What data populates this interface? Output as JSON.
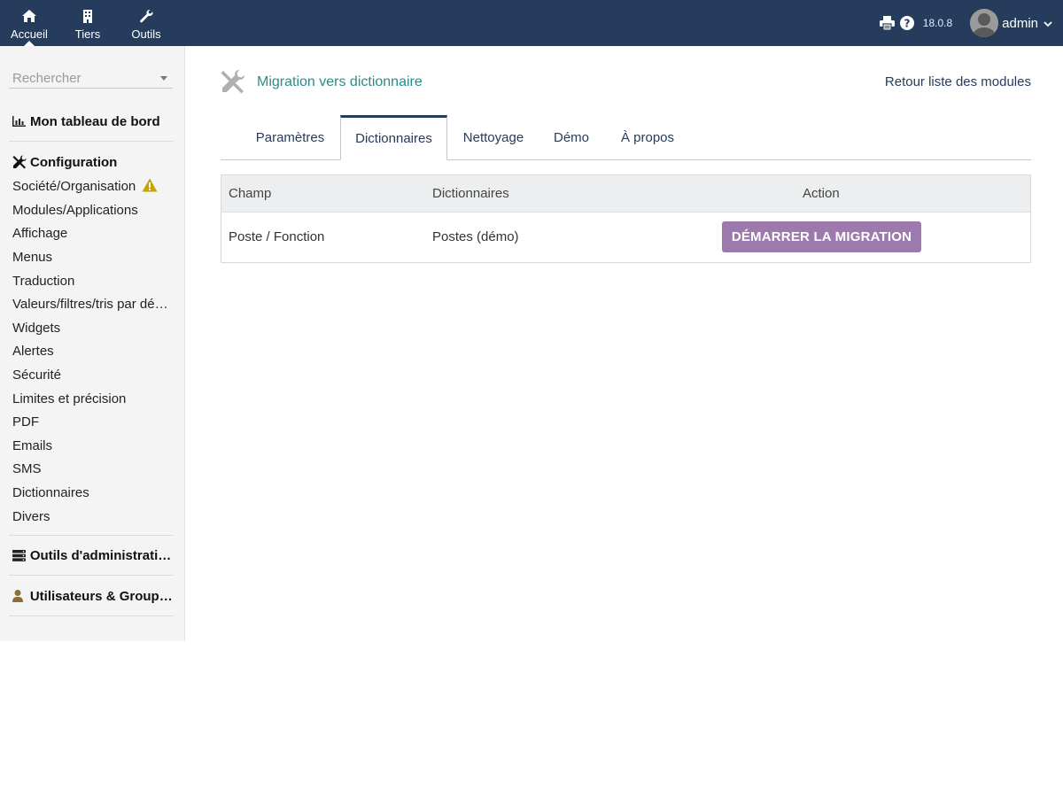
{
  "topmenu": [
    {
      "label": "Accueil",
      "icon": "home-icon"
    },
    {
      "label": "Tiers",
      "icon": "building-icon"
    },
    {
      "label": "Outils",
      "icon": "wrench-icon"
    }
  ],
  "topright": {
    "version": "18.0.8",
    "username": "admin"
  },
  "sidebar": {
    "search_placeholder": "Rechercher",
    "dashboard": "Mon tableau de bord",
    "configuration": "Configuration",
    "config_items": [
      "Société/Organisation",
      "Modules/Applications",
      "Affichage",
      "Menus",
      "Traduction",
      "Valeurs/filtres/tris par défaut",
      "Widgets",
      "Alertes",
      "Sécurité",
      "Limites et précision",
      "PDF",
      "Emails",
      "SMS",
      "Dictionnaires",
      "Divers"
    ],
    "admin_tools": "Outils d'administration",
    "users_groups": "Utilisateurs & Groupes"
  },
  "main": {
    "title": "Migration vers dictionnaire",
    "back_link": "Retour liste des modules",
    "tabs": [
      "Paramètres",
      "Dictionnaires",
      "Nettoyage",
      "Démo",
      "À propos"
    ],
    "active_tab": "Dictionnaires",
    "table": {
      "headers": [
        "Champ",
        "Dictionnaires",
        "Action"
      ],
      "rows": [
        {
          "champ": "Poste / Fonction",
          "dictionnaire": "Postes (démo)",
          "action": "DÉMARRER LA MIGRATION"
        }
      ]
    }
  },
  "colors": {
    "topbar": "#263c5c",
    "title": "#2b8b8b",
    "button": "#9d7aad",
    "warning": "#c9a100"
  }
}
